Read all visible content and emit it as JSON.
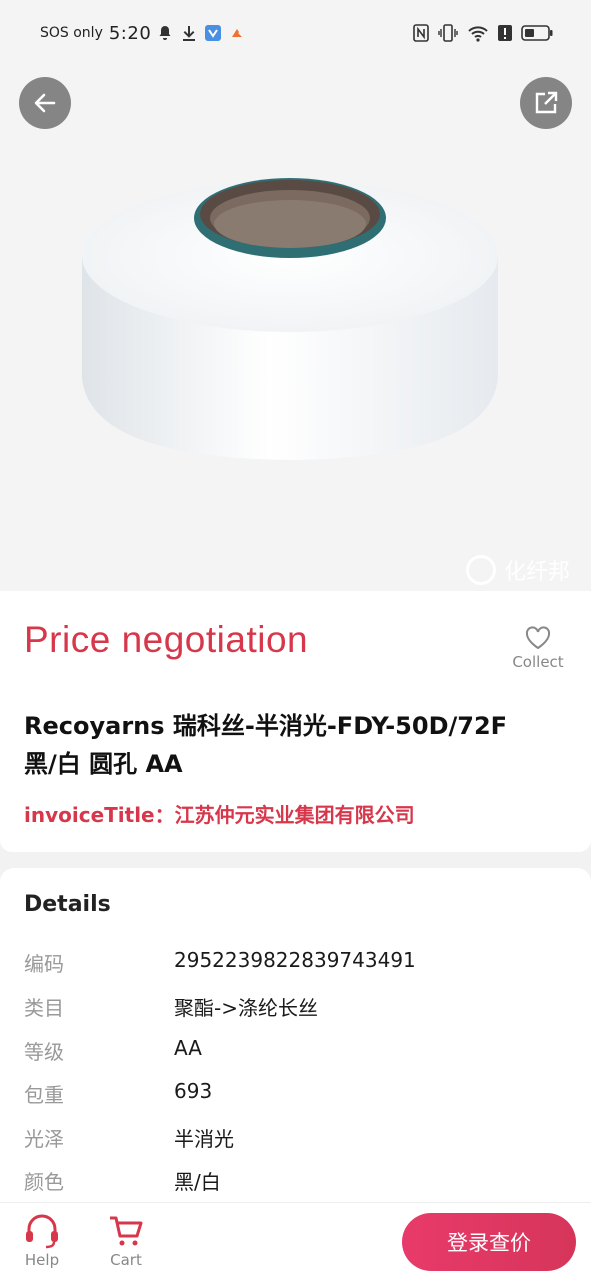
{
  "status_bar": {
    "carrier": "SOS only",
    "time": "5:20",
    "colors": {
      "app_icon_bg": "#4a90e2",
      "app_icon2": "#f07030"
    }
  },
  "hero": {
    "watermark_text": "化纤邦",
    "back_icon": "arrow-left-icon",
    "share_icon": "external-link-icon"
  },
  "product": {
    "price_text": "Price negotiation",
    "title_line1": "Recoyarns 瑞科丝-半消光-FDY-50D/72F",
    "title_line2": "黑/白 圆孔 AA",
    "invoice_text": "invoiceTitle：江苏仲元实业集团有限公司",
    "collect_label": "Collect"
  },
  "details": {
    "heading": "Details",
    "rows": [
      {
        "label": "编码",
        "value": "2952239822839743491"
      },
      {
        "label": "类目",
        "value": "聚酯->涤纶长丝"
      },
      {
        "label": "等级",
        "value": "AA"
      },
      {
        "label": "包重",
        "value": "693"
      },
      {
        "label": "光泽",
        "value": "半消光"
      },
      {
        "label": "颜色",
        "value": "黑/白"
      }
    ]
  },
  "bottom_bar": {
    "help_label": "Help",
    "cart_label": "Cart",
    "login_label": "登录查价"
  },
  "colors": {
    "accent": "#d7374a",
    "button_gradient_start": "#e83a6a",
    "button_gradient_end": "#d6355a"
  }
}
